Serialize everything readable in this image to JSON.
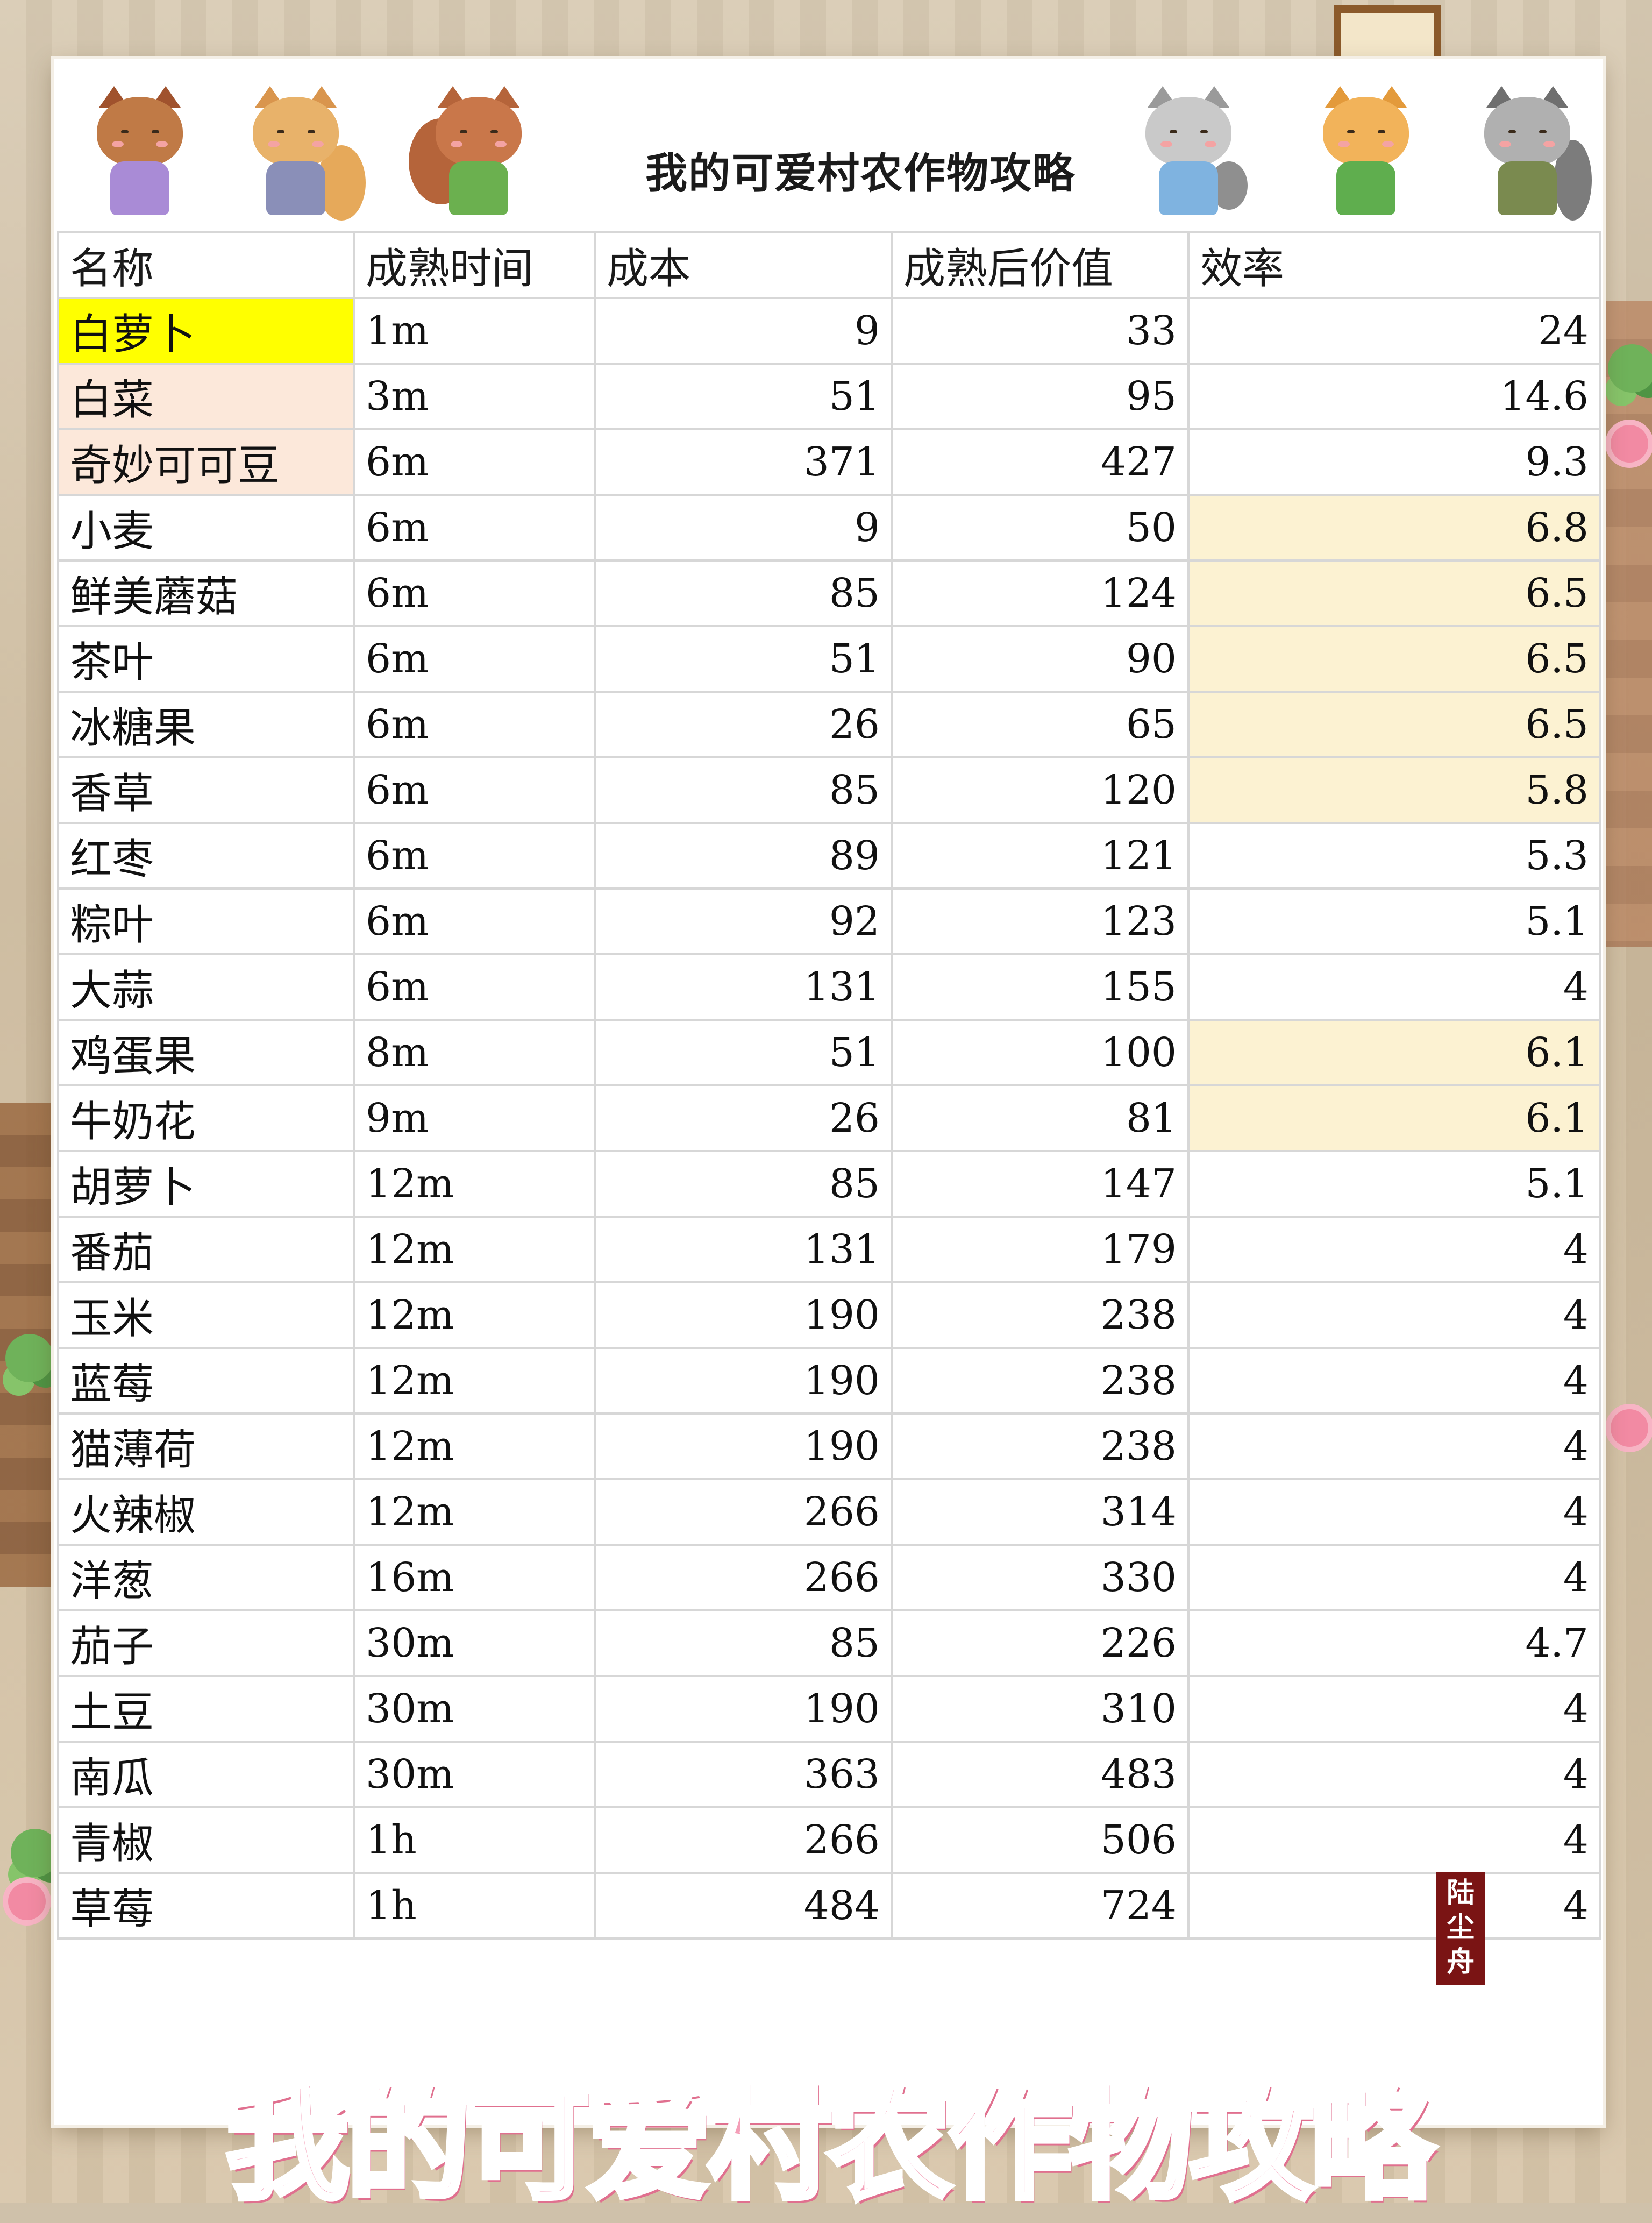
{
  "header": {
    "title": "我的可爱村农作物攻略"
  },
  "banner": {
    "text": "我的可爱村农作物攻略"
  },
  "seal": {
    "text": "陆尘舟"
  },
  "mascots": [
    "deer-mascot",
    "fox-mascot",
    "squirrel-mascot",
    "cat-mascot",
    "shiba-mascot",
    "raccoon-mascot"
  ],
  "colors": {
    "highlight_yellow": "#FFFF00",
    "highlight_peach": "#FCE8DA",
    "highlight_cream": "#FCF2D2",
    "banner_pink": "#F49FB8",
    "seal_red": "#7A1414"
  },
  "table": {
    "columns": [
      "名称",
      "成熟时间",
      "成本",
      "成熟后价值",
      "效率"
    ],
    "rows": [
      {
        "name": "白萝卜",
        "time": "1m",
        "cost": "9",
        "value": "33",
        "eff": "24",
        "name_hl": "yellow",
        "eff_hl": ""
      },
      {
        "name": "白菜",
        "time": "3m",
        "cost": "51",
        "value": "95",
        "eff": "14.6",
        "name_hl": "peach",
        "eff_hl": ""
      },
      {
        "name": "奇妙可可豆",
        "time": "6m",
        "cost": "371",
        "value": "427",
        "eff": "9.3",
        "name_hl": "peach",
        "eff_hl": ""
      },
      {
        "name": "小麦",
        "time": "6m",
        "cost": "9",
        "value": "50",
        "eff": "6.8",
        "name_hl": "",
        "eff_hl": "cream"
      },
      {
        "name": "鲜美蘑菇",
        "time": "6m",
        "cost": "85",
        "value": "124",
        "eff": "6.5",
        "name_hl": "",
        "eff_hl": "cream"
      },
      {
        "name": "茶叶",
        "time": "6m",
        "cost": "51",
        "value": "90",
        "eff": "6.5",
        "name_hl": "",
        "eff_hl": "cream"
      },
      {
        "name": "冰糖果",
        "time": "6m",
        "cost": "26",
        "value": "65",
        "eff": "6.5",
        "name_hl": "",
        "eff_hl": "cream"
      },
      {
        "name": "香草",
        "time": "6m",
        "cost": "85",
        "value": "120",
        "eff": "5.8",
        "name_hl": "",
        "eff_hl": "cream"
      },
      {
        "name": "红枣",
        "time": "6m",
        "cost": "89",
        "value": "121",
        "eff": "5.3",
        "name_hl": "",
        "eff_hl": ""
      },
      {
        "name": "粽叶",
        "time": "6m",
        "cost": "92",
        "value": "123",
        "eff": "5.1",
        "name_hl": "",
        "eff_hl": ""
      },
      {
        "name": "大蒜",
        "time": "6m",
        "cost": "131",
        "value": "155",
        "eff": "4",
        "name_hl": "",
        "eff_hl": ""
      },
      {
        "name": "鸡蛋果",
        "time": "8m",
        "cost": "51",
        "value": "100",
        "eff": "6.1",
        "name_hl": "",
        "eff_hl": "cream"
      },
      {
        "name": "牛奶花",
        "time": "9m",
        "cost": "26",
        "value": "81",
        "eff": "6.1",
        "name_hl": "",
        "eff_hl": "cream"
      },
      {
        "name": "胡萝卜",
        "time": "12m",
        "cost": "85",
        "value": "147",
        "eff": "5.1",
        "name_hl": "",
        "eff_hl": ""
      },
      {
        "name": "番茄",
        "time": "12m",
        "cost": "131",
        "value": "179",
        "eff": "4",
        "name_hl": "",
        "eff_hl": ""
      },
      {
        "name": "玉米",
        "time": "12m",
        "cost": "190",
        "value": "238",
        "eff": "4",
        "name_hl": "",
        "eff_hl": ""
      },
      {
        "name": "蓝莓",
        "time": "12m",
        "cost": "190",
        "value": "238",
        "eff": "4",
        "name_hl": "",
        "eff_hl": ""
      },
      {
        "name": "猫薄荷",
        "time": "12m",
        "cost": "190",
        "value": "238",
        "eff": "4",
        "name_hl": "",
        "eff_hl": ""
      },
      {
        "name": "火辣椒",
        "time": "12m",
        "cost": "266",
        "value": "314",
        "eff": "4",
        "name_hl": "",
        "eff_hl": ""
      },
      {
        "name": "洋葱",
        "time": "16m",
        "cost": "266",
        "value": "330",
        "eff": "4",
        "name_hl": "",
        "eff_hl": ""
      },
      {
        "name": "茄子",
        "time": "30m",
        "cost": "85",
        "value": "226",
        "eff": "4.7",
        "name_hl": "",
        "eff_hl": ""
      },
      {
        "name": "土豆",
        "time": "30m",
        "cost": "190",
        "value": "310",
        "eff": "4",
        "name_hl": "",
        "eff_hl": ""
      },
      {
        "name": "南瓜",
        "time": "30m",
        "cost": "363",
        "value": "483",
        "eff": "4",
        "name_hl": "",
        "eff_hl": ""
      },
      {
        "name": "青椒",
        "time": "1h",
        "cost": "266",
        "value": "506",
        "eff": "4",
        "name_hl": "",
        "eff_hl": ""
      },
      {
        "name": "草莓",
        "time": "1h",
        "cost": "484",
        "value": "724",
        "eff": "4",
        "name_hl": "",
        "eff_hl": ""
      }
    ]
  }
}
